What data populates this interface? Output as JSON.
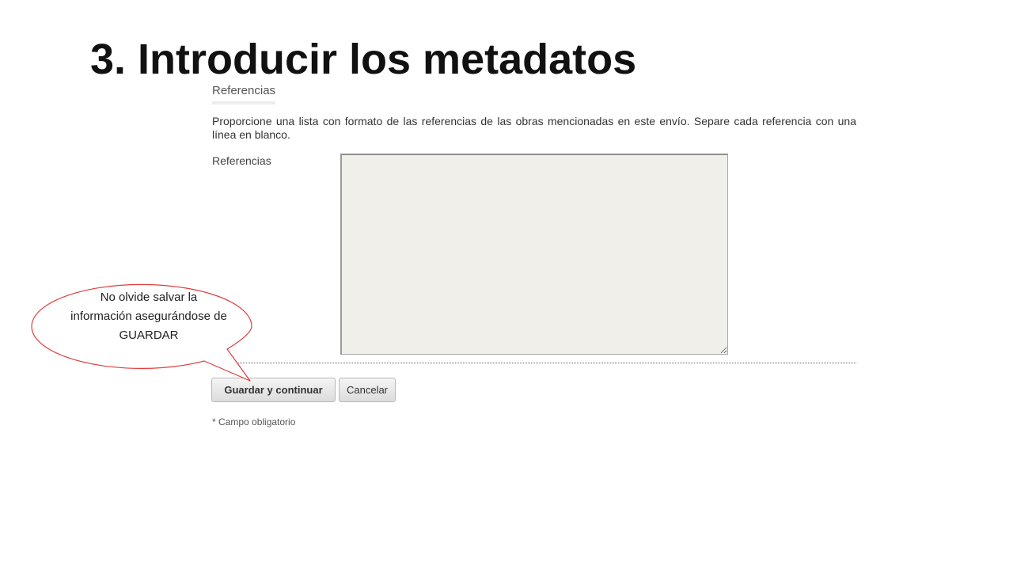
{
  "slide": {
    "title": "3. Introducir los metadatos"
  },
  "form": {
    "section_heading": "Referencias",
    "instructions": "Proporcione una lista con formato de las referencias de las obras mencionadas en este envío. Separe cada referencia con una línea en blanco.",
    "field_label": "Referencias",
    "field_value": "",
    "save_button_label": "Guardar y continuar",
    "cancel_button_label": "Cancelar",
    "required_note": "* Campo obligatorio"
  },
  "callout": {
    "text": "No olvide salvar la información asegurándose de GUARDAR",
    "border_color": "#e03c3c"
  }
}
